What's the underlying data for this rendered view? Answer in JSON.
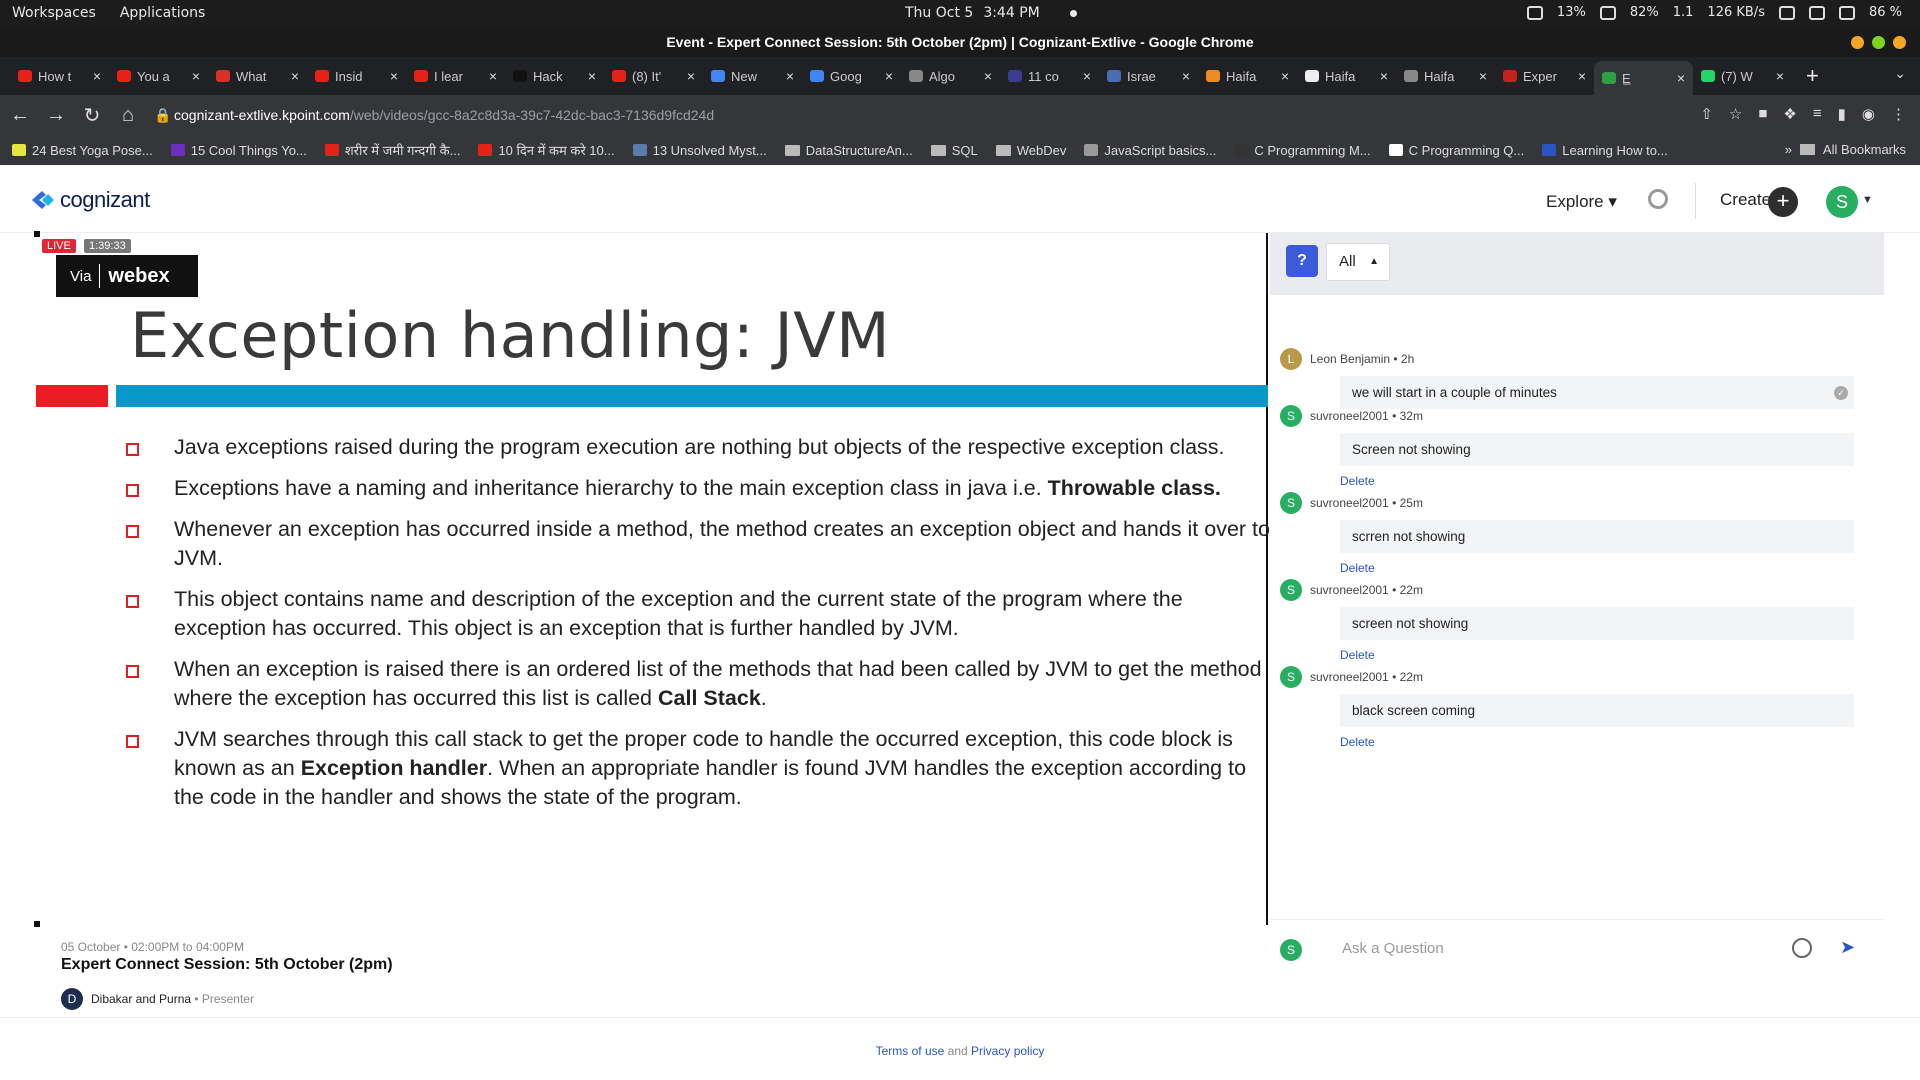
{
  "system_bar": {
    "workspaces": "Workspaces",
    "applications": "Applications",
    "date": "Thu Oct 5",
    "time": "3:44 PM",
    "cpu": "13%",
    "battery_icon_pct": "82%",
    "load": "1.1",
    "net": "126 KB/s",
    "battery": "86 %"
  },
  "window_title": "Event - Expert Connect Session: 5th October (2pm) | Cognizant-Extlive - Google Chrome",
  "tabs": [
    {
      "title": "How t",
      "color": "#e62117"
    },
    {
      "title": "You a",
      "color": "#e62117"
    },
    {
      "title": "What",
      "color": "#d93025"
    },
    {
      "title": "Insid",
      "color": "#e62117"
    },
    {
      "title": "I lear",
      "color": "#e62117"
    },
    {
      "title": "Hack",
      "color": "#111111"
    },
    {
      "title": "(8) It'",
      "color": "#e62117"
    },
    {
      "title": "New",
      "color": "#4285f4"
    },
    {
      "title": "Goog",
      "color": "#4285f4"
    },
    {
      "title": "Algo",
      "color": "#888888"
    },
    {
      "title": "11 co",
      "color": "#3b3b8f"
    },
    {
      "title": "Israe",
      "color": "#4a6cb0"
    },
    {
      "title": "Haifa",
      "color": "#f08a24"
    },
    {
      "title": "Haifa",
      "color": "#eeeeee"
    },
    {
      "title": "Haifa",
      "color": "#888888"
    },
    {
      "title": "Exper",
      "color": "#c5221f"
    },
    {
      "title": "E̲",
      "color": "#2ea043"
    },
    {
      "title": "(7) W",
      "color": "#25d366"
    }
  ],
  "address": {
    "host": "cognizant-extlive.kpoint.com",
    "path": "/web/videos/gcc-8a2c8d3a-39c7-42dc-bac3-7136d9fcd24d"
  },
  "bookmarks": [
    {
      "label": "24 Best Yoga Pose...",
      "color": "#e5e53f"
    },
    {
      "label": "15 Cool Things Yo...",
      "color": "#6b2fbf"
    },
    {
      "label": "शरीर में जमी गन्दगी कै...",
      "color": "#e62117"
    },
    {
      "label": "10 दिन में कम करे 10...",
      "color": "#e62117"
    },
    {
      "label": "13 Unsolved Myst...",
      "color": "#5a7ca8"
    },
    {
      "label": "DataStructureAn...",
      "folder": true
    },
    {
      "label": "SQL",
      "folder": true
    },
    {
      "label": "WebDev",
      "folder": true
    },
    {
      "label": "JavaScript basics...",
      "color": "#999999"
    },
    {
      "label": "C Programming M...",
      "color": "#333333"
    },
    {
      "label": "C Programming Q...",
      "color": "#ffffff"
    },
    {
      "label": "Learning How to...",
      "color": "#2a55c7"
    }
  ],
  "all_bookmarks": "All Bookmarks",
  "app": {
    "logo": "cognizant",
    "explore": "Explore",
    "create": "Create",
    "avatar": "S"
  },
  "video": {
    "live": "LIVE",
    "duration": "1:39:33",
    "via": "Via",
    "webex": "webex",
    "slide_title": "Exception handling: JVM",
    "bullets": [
      {
        "text": "Java exceptions raised during the program execution are nothing but objects of the respective exception class.",
        "bold": "",
        "tail": ""
      },
      {
        "text": "Exceptions have a naming and inheritance hierarchy to the main exception class in java i.e. ",
        "bold": "Throwable class.",
        "tail": ""
      },
      {
        "text": "Whenever an exception has occurred inside a method, the method creates an exception object and hands it over to JVM.",
        "bold": "",
        "tail": ""
      },
      {
        "text": "This object contains name and description of the exception and the current state of the program where the exception has occurred. This object is an exception that is further handled by JVM.",
        "bold": "",
        "tail": ""
      },
      {
        "text": "When an exception is raised there is an ordered list of the methods that had been called by JVM to get the method where the exception has occurred this list is called ",
        "bold": "Call Stack",
        "tail": "."
      },
      {
        "text": "JVM searches through this call stack to get the proper code to handle the occurred exception, this code block is known as an ",
        "bold": "Exception handler",
        "tail": ". When an appropriate handler is found JVM handles the exception according to the code in the handler and shows the state of the program."
      }
    ]
  },
  "event": {
    "time": "05 October • 02:00PM to 04:00PM",
    "title": "Expert Connect Session: 5th October (2pm)",
    "presenter_initial": "D",
    "presenter": "Dibakar and Purna",
    "role": " • Presenter"
  },
  "footer": {
    "terms": "Terms of use",
    "and": " and ",
    "privacy": "Privacy policy"
  },
  "qa": {
    "filter": "All",
    "messages": [
      {
        "initial": "L",
        "author": "Leon Benjamin",
        "ago": " • 2h",
        "text": "we will start in a couple of minutes",
        "color": "#b89a4a",
        "answered": true,
        "delete": ""
      },
      {
        "initial": "S",
        "author": "suvroneel2001",
        "ago": " • 32m",
        "text": "Screen not showing",
        "color": "#27ae60",
        "answered": false,
        "delete": "Delete"
      },
      {
        "initial": "S",
        "author": "suvroneel2001",
        "ago": " • 25m",
        "text": "scrren not showing",
        "color": "#27ae60",
        "answered": false,
        "delete": "Delete"
      },
      {
        "initial": "S",
        "author": "suvroneel2001",
        "ago": " • 22m",
        "text": "screen not showing",
        "color": "#27ae60",
        "answered": false,
        "delete": "Delete"
      },
      {
        "initial": "S",
        "author": "suvroneel2001",
        "ago": " • 22m",
        "text": "black screen coming",
        "color": "#27ae60",
        "answered": false,
        "delete": "Delete"
      }
    ],
    "ask_placeholder": "Ask a Question",
    "ask_avatar": "S"
  }
}
